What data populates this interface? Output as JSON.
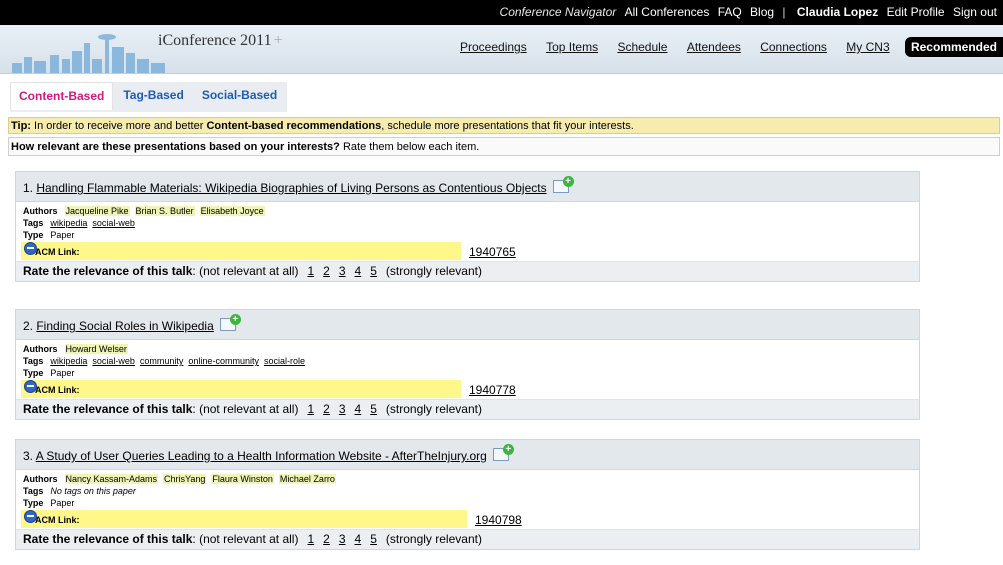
{
  "topbar": {
    "conference_navigator": "Conference Navigator",
    "all_conferences": "All Conferences",
    "faq": "FAQ",
    "blog": "Blog",
    "separator": "|",
    "user": "Claudia Lopez",
    "edit_profile": "Edit Profile",
    "sign_out": "Sign out"
  },
  "header": {
    "site_title": "iConference 2011",
    "nav": [
      "Proceedings",
      "Top Items",
      "Schedule",
      "Attendees",
      "Connections",
      "My CN3"
    ],
    "active_nav": "Recommended"
  },
  "tabs": [
    "Content-Based",
    "Tag-Based",
    "Social-Based"
  ],
  "tip": {
    "label": "Tip:",
    "text1": " In order to receive more and better ",
    "strong": "Content-based recommendations",
    "text2": ", schedule more presentations that fit your interests."
  },
  "question": {
    "strong": "How relevant are these presentations based on your interests?",
    "text": " Rate them below each item."
  },
  "labels": {
    "authors": "Authors",
    "tags": "Tags",
    "type": "Type",
    "acm_link": "ACM Link:",
    "rate_label": "Rate the relevance of this talk",
    "rate_low": ": (not relevant at all)",
    "rate_high": "(strongly relevant)",
    "ratings": [
      "1",
      "2",
      "3",
      "4",
      "5"
    ]
  },
  "papers": [
    {
      "num": "1.",
      "title": "Handling Flammable Materials: Wikipedia Biographies of Living Persons as Contentious Objects",
      "authors": [
        "Jacqueline Pike",
        "Brian S. Butler",
        "Elisabeth Joyce"
      ],
      "tags": [
        "wikipedia",
        "social-web"
      ],
      "tags_empty": "",
      "type": "Paper",
      "acm": "1940765"
    },
    {
      "num": "2.",
      "title": "Finding Social Roles in Wikipedia",
      "authors": [
        "Howard Welser"
      ],
      "tags": [
        "wikipedia",
        "social-web",
        "community",
        "online-community",
        "social-role"
      ],
      "tags_empty": "",
      "type": "Paper",
      "acm": "1940778"
    },
    {
      "num": "3.",
      "title": "A Study of User Queries Leading to a Health Information Website - AfterTheInjury.org",
      "authors": [
        "Nancy Kassam-Adams",
        "ChrisYang",
        "Flaura Winston",
        "Michael Zarro"
      ],
      "tags": [],
      "tags_empty": "No tags on this paper",
      "type": "Paper",
      "acm": "1940798"
    }
  ]
}
